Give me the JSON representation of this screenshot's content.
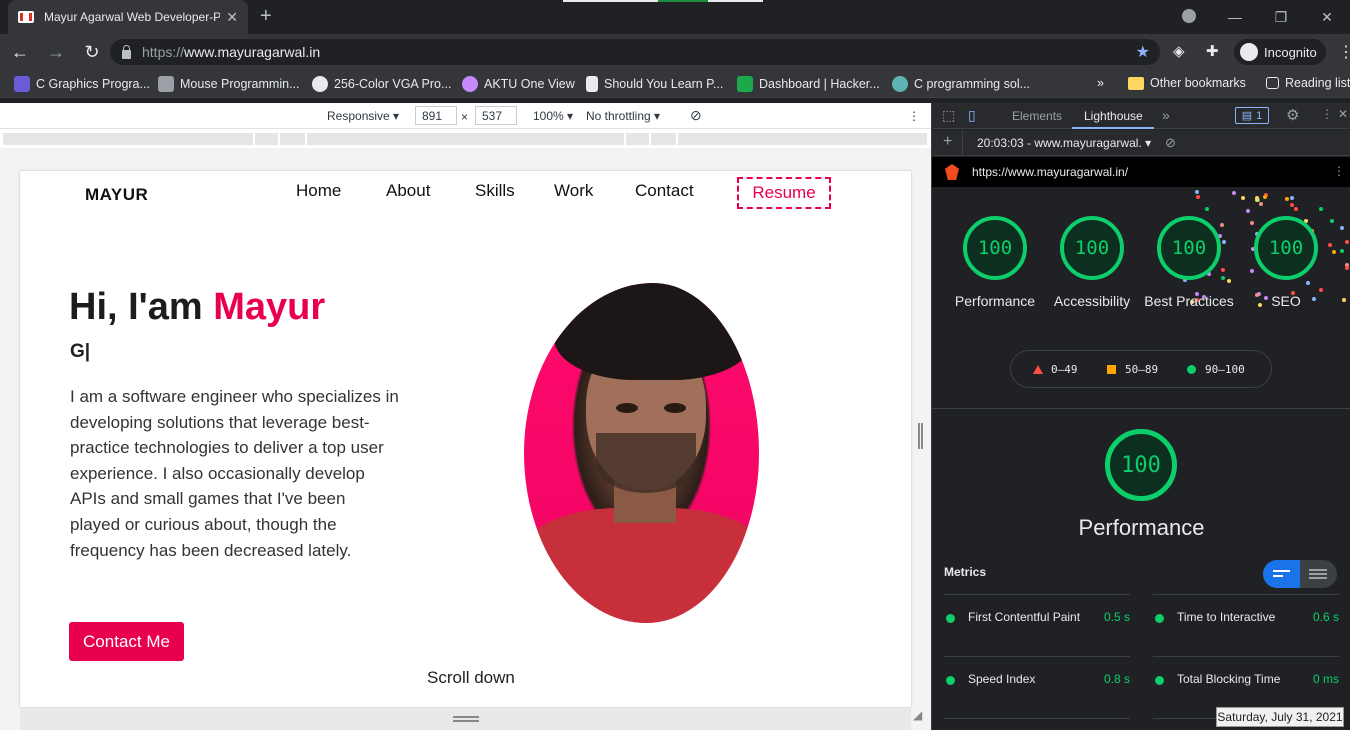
{
  "browser": {
    "tab_title": "Mayur Agarwal Web Developer-P",
    "tab_close": "✕",
    "new_tab": "+",
    "url_scheme": "https://",
    "url_host": "www.mayuragarwal.in",
    "incognito_label": "Incognito",
    "window_controls": [
      "—",
      "❐",
      "✕"
    ]
  },
  "bookmarks": [
    {
      "label": "C Graphics Progra...",
      "color": "#6b5bd6"
    },
    {
      "label": "Mouse Programmin...",
      "color": "#9aa0a6"
    },
    {
      "label": "256-Color VGA Pro...",
      "color": "#e8eaed"
    },
    {
      "label": "AKTU One View",
      "color": "#c58af9"
    },
    {
      "label": "Should You Learn P...",
      "color": "#e8eaed"
    },
    {
      "label": "Dashboard | Hacker...",
      "color": "#1ba94c"
    },
    {
      "label": "C programming sol...",
      "color": "#5fb3b3"
    }
  ],
  "bookmarks_right": {
    "more": "»",
    "other": "Other bookmarks",
    "reading": "Reading list"
  },
  "device_toolbar": {
    "mode": "Responsive ▾",
    "width": "891",
    "times": "×",
    "height": "537",
    "zoom": "100% ▾",
    "throttling": "No throttling ▾",
    "menu": "⋮"
  },
  "site": {
    "logo": "MAYUR",
    "nav": [
      "Home",
      "About",
      "Skills",
      "Work",
      "Contact"
    ],
    "resume": "Resume",
    "greeting_prefix": "Hi, I'am ",
    "greeting_name": "Mayur",
    "typing": "G|",
    "bio": "I am a software engineer who specializes in developing solutions that leverage best-practice technologies to deliver a top user experience. I also occasionally develop APIs and small games that I've been played or curious about, though the frequency has been decreased lately.",
    "cta": "Contact Me",
    "scroll_hint": "Scroll down"
  },
  "devtools": {
    "tabs": [
      "Elements",
      "Lighthouse"
    ],
    "more": "»",
    "issues_badge": "1",
    "report_time": "20:03:03 - www.mayuragarwal. ▾",
    "audited_url": "https://www.mayuragarwal.in/",
    "scores": [
      {
        "label": "Performance",
        "value": "100"
      },
      {
        "label": "Accessibility",
        "value": "100"
      },
      {
        "label": "Best Practices",
        "value": "100"
      },
      {
        "label": "SEO",
        "value": "100"
      }
    ],
    "legend": [
      "0–49",
      "50–89",
      "90–100"
    ],
    "focus_score": "100",
    "focus_label": "Performance",
    "metrics_heading": "Metrics",
    "metrics": [
      {
        "name": "First Contentful Paint",
        "value": "0.5 s"
      },
      {
        "name": "Time to Interactive",
        "value": "0.6 s"
      },
      {
        "name": "Speed Index",
        "value": "0.8 s"
      },
      {
        "name": "Total Blocking Time",
        "value": "0 ms"
      }
    ],
    "good_color": "#0cce6b"
  },
  "taskbar": {
    "date": "Saturday, July 31, 2021"
  }
}
